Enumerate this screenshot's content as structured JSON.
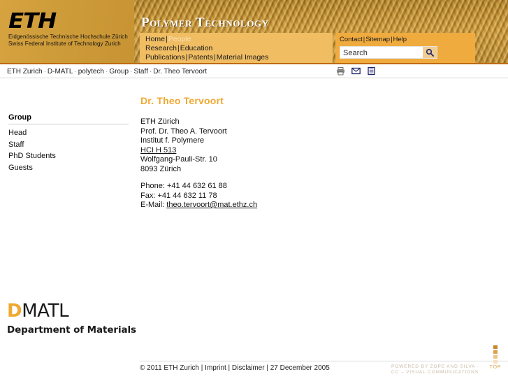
{
  "header": {
    "logo": {
      "wordmark": "ETH",
      "line1": "Eidgenössische Technische Hochschule Zürich",
      "line2": "Swiss Federal Institute of Technology Zurich"
    },
    "site_title": "Polymer Technology",
    "nav_rows": [
      [
        {
          "label": "Home",
          "active": false
        },
        {
          "label": "People",
          "active": true
        }
      ],
      [
        {
          "label": "Research",
          "active": false
        },
        {
          "label": "Education",
          "active": false
        }
      ],
      [
        {
          "label": "Publications",
          "active": false
        },
        {
          "label": "Patents",
          "active": false
        },
        {
          "label": "Material Images",
          "active": false
        }
      ]
    ],
    "utility_links": [
      "Contact",
      "Sitemap",
      "Help"
    ],
    "search": {
      "value": "Search",
      "placeholder": "Search",
      "button_icon": "search-icon"
    },
    "separator": "|"
  },
  "breadcrumb": {
    "separator": "·",
    "items": [
      "ETH Zurich",
      "D-MATL",
      "polytech",
      "Group",
      "Staff",
      "Dr. Theo Tervoort"
    ],
    "icons": [
      "print-icon",
      "email-icon",
      "page-icon"
    ]
  },
  "sidebar": {
    "title": "Group",
    "items": [
      {
        "label": "Head"
      },
      {
        "label": "Staff"
      },
      {
        "label": "PhD Students"
      },
      {
        "label": "Guests"
      }
    ]
  },
  "main": {
    "title": "Dr. Theo Tervoort",
    "address": [
      {
        "text": "ETH Zürich",
        "link": false
      },
      {
        "text": "Prof. Dr. Theo A. Tervoort",
        "link": false
      },
      {
        "text": "Institut f. Polymere",
        "link": false
      },
      {
        "text": "HCI H 513",
        "link": true
      },
      {
        "text": "Wolfgang-Pauli-Str. 10",
        "link": false
      },
      {
        "text": "8093 Zürich",
        "link": false
      }
    ],
    "contact": {
      "phone_label": "Phone:",
      "phone_value": "+41 44 632 61 88",
      "fax_label": "Fax:",
      "fax_value": "+41 44 632 11 78",
      "email_label": "E-Mail:",
      "email_value": "theo.tervoort@mat.ethz.ch"
    }
  },
  "dmatl": {
    "initial": "D",
    "rest": "MATL",
    "subtitle": "Department of Materials"
  },
  "footer": {
    "copyright": "© 2011 ETH Zurich",
    "separator": "|",
    "links": [
      "Imprint",
      "Disclaimer"
    ],
    "date": "27 December 2005",
    "powered_line1": "POWERED BY ZOPE AND SILVA ·",
    "powered_line2": "CC – VISUAL COMMUNICATIONS",
    "top_label": "TOP"
  },
  "colors": {
    "accent": "#f0a830",
    "header_gold": "#b3822a",
    "nav_bg": "#f0bd63",
    "nav_right_bg": "#f0ab3e",
    "rule": "#c06a12"
  }
}
